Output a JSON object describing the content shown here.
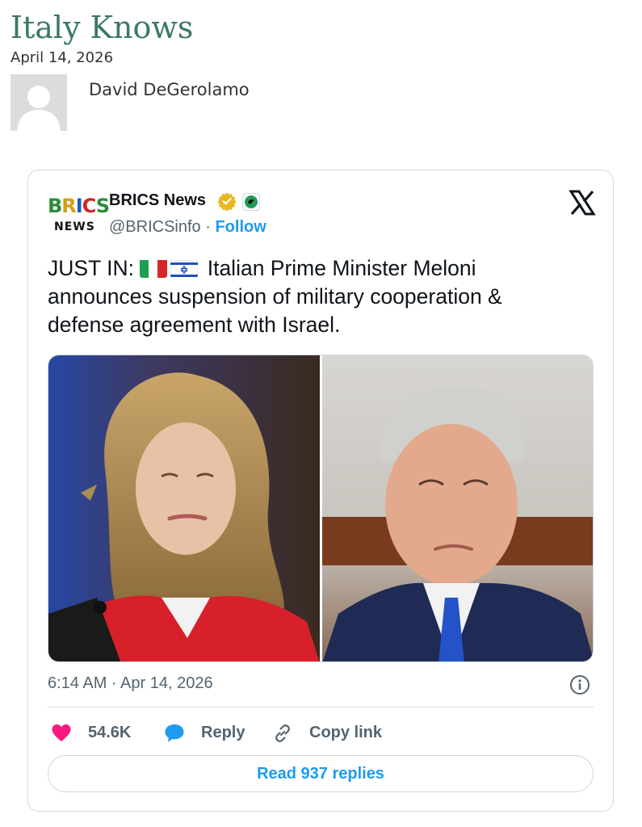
{
  "post": {
    "title": "Italy Knows",
    "date": "April 14, 2026",
    "author": "David DeGerolamo"
  },
  "tweet": {
    "logo_text_top": "BRICS",
    "logo_text_bottom": "NEWS",
    "account_name": "BRICS News",
    "handle": "@BRICSinfo",
    "separator": "·",
    "follow_label": "Follow",
    "text_prefix": "JUST IN: ",
    "text_body": " Italian Prime Minister Meloni announces suspension of military cooperation & defense agreement with Israel.",
    "timestamp": "6:14 AM · Apr 14, 2026",
    "like_count": "54.6K",
    "reply_label": "Reply",
    "copy_link_label": "Copy link",
    "read_replies_label": "Read 937 replies"
  },
  "icons": {
    "verified": "verified-badge-icon",
    "affiliate": "affiliate-badge-icon",
    "x_logo": "x-logo-icon",
    "info": "info-icon",
    "like": "heart-icon",
    "reply": "reply-bubble-icon",
    "copy": "link-icon"
  },
  "colors": {
    "title_green": "#3b7a5f",
    "link_blue": "#1d9bf0",
    "like_pink": "#f91880",
    "muted_text": "#536471",
    "border": "#cfd9de"
  }
}
